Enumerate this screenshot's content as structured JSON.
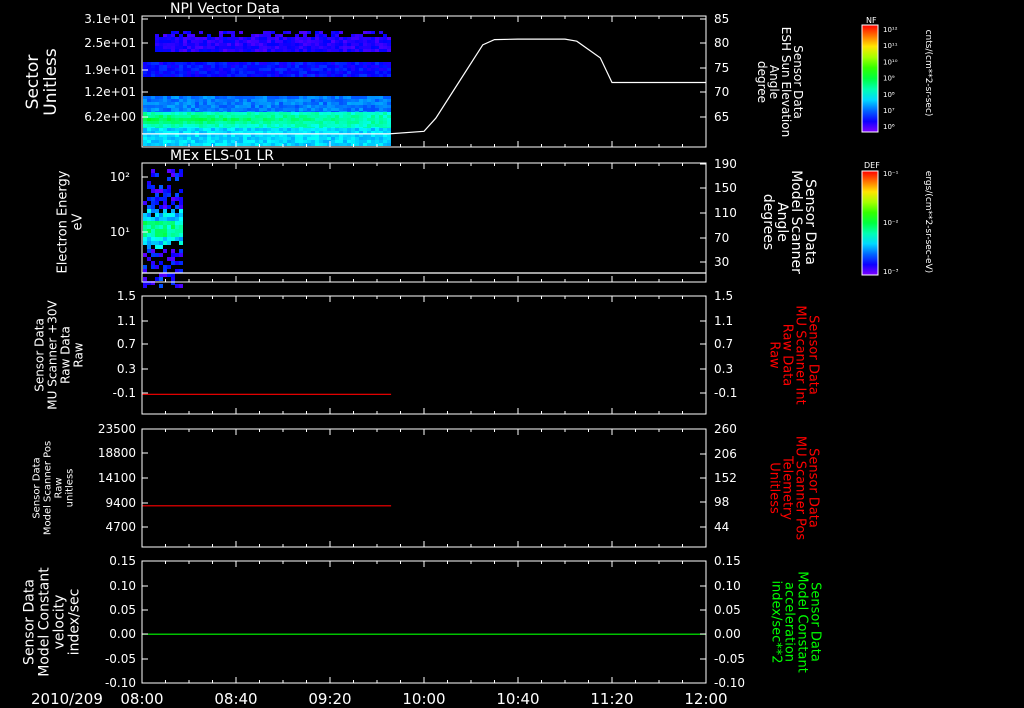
{
  "colors": {
    "background": "#000000",
    "foreground": "#ffffff",
    "red_series": "#ff0000",
    "green_series": "#00ff00"
  },
  "time_axis": {
    "date_label": "2010/209",
    "ticks": [
      "08:00",
      "08:40",
      "09:20",
      "10:00",
      "10:40",
      "11:20",
      "12:00"
    ]
  },
  "chart_data": [
    {
      "type": "heatmap",
      "title": "NPI Vector Data",
      "ylabel": [
        "Sector",
        "Unitless"
      ],
      "ytick_labels": [
        "3.1e+01",
        "2.5e+01",
        "1.9e+01",
        "1.2e+01",
        "6.2e+00"
      ],
      "right_axis": {
        "label": [
          "Sensor Data",
          "ESH Sun Elevation",
          "Angle",
          "degree"
        ],
        "ticks": [
          "85",
          "80",
          "75",
          "70",
          "65"
        ],
        "ylim": [
          60,
          85
        ]
      },
      "colorbar": {
        "title": "NF",
        "unit": "cnts/(cm**2-sr-sec)",
        "tick_labels": [
          "10¹²",
          "10¹¹",
          "10¹⁰",
          "10⁹",
          "10⁸",
          "10⁷",
          "10⁶"
        ],
        "colormap": "rainbow"
      },
      "data_extent": {
        "start": "08:00",
        "end": "09:45"
      },
      "line_series": {
        "name": "ESH Sun Elevation Angle",
        "x": [
          "08:00",
          "09:45",
          "10:00",
          "10:05",
          "10:15",
          "10:25",
          "10:30",
          "10:40",
          "11:00",
          "11:05",
          "11:15",
          "11:20",
          "12:00"
        ],
        "y": [
          62.5,
          62.5,
          63.0,
          65.5,
          72.5,
          79.5,
          80.5,
          80.6,
          80.6,
          80.2,
          77.0,
          72.3,
          72.3
        ]
      }
    },
    {
      "type": "heatmap",
      "title": "MEx ELS-01 LR",
      "ylabel": [
        "Electron Energy",
        "eV"
      ],
      "ytick_labels": [
        "10²",
        "10¹"
      ],
      "right_axis": {
        "label": [
          "Sensor Data",
          "Model Scanner",
          "Angle",
          "degrees"
        ],
        "ticks": [
          "190",
          "150",
          "110",
          "70",
          "30"
        ],
        "ylim": [
          10,
          190
        ]
      },
      "colorbar": {
        "title": "DEF",
        "unit": "ergs/(cm**2-sr-sec-eV)",
        "tick_labels": [
          "10⁻¹",
          "10⁻²",
          "10⁻³"
        ],
        "colormap": "rainbow"
      },
      "data_extent": {
        "start": "08:00",
        "end": "08:17"
      },
      "line_series": {
        "name": "Model Scanner Angle",
        "x": [
          "08:00",
          "12:00"
        ],
        "y": [
          10,
          10
        ]
      }
    },
    {
      "type": "line",
      "ylabel": [
        "Sensor Data",
        "MU Scanner +30V",
        "Raw Data",
        "Raw"
      ],
      "yticks": [
        "1.5",
        "1.1",
        "0.7",
        "0.3",
        "-0.1"
      ],
      "ylim": [
        -0.3,
        1.5
      ],
      "right_axis": {
        "label": [
          "Sensor Data",
          "MU Scanner Int",
          "Raw Data",
          "Raw"
        ],
        "ticks": [
          "1.5",
          "1.1",
          "0.7",
          "0.3",
          "-0.1"
        ],
        "color": "#ff0000"
      },
      "series": [
        {
          "color": "#ff0000",
          "x": [
            "08:00",
            "09:46"
          ],
          "y": [
            0.0,
            0.0
          ]
        }
      ]
    },
    {
      "type": "line",
      "ylabel": [
        "Sensor Data",
        "Model Scanner Pos",
        "Raw",
        "unitless"
      ],
      "yticks": [
        "23500",
        "18800",
        "14100",
        "9400",
        "4700"
      ],
      "ylim": [
        0,
        23500
      ],
      "right_axis": {
        "label": [
          "Sensor Data",
          "MU Scanner Pos",
          "Telemetry",
          "Unitless"
        ],
        "ticks": [
          "260",
          "206",
          "152",
          "98",
          "44"
        ],
        "color": "#ff0000"
      },
      "series": [
        {
          "color": "#ff0000",
          "x": [
            "08:00",
            "09:46"
          ],
          "y": [
            8200,
            8200
          ]
        }
      ]
    },
    {
      "type": "line",
      "ylabel": [
        "Sensor Data",
        "Model Constant",
        "velocity",
        "index/sec"
      ],
      "yticks": [
        "0.15",
        "0.10",
        "0.05",
        "0.00",
        "-0.05",
        "-0.10"
      ],
      "ylim": [
        -0.1,
        0.15
      ],
      "right_axis": {
        "label": [
          "Sensor Data",
          "Model Constant",
          "acceleration",
          "index/sec**2"
        ],
        "ticks": [
          "0.15",
          "0.10",
          "0.05",
          "0.00",
          "-0.05",
          "-0.10"
        ],
        "color": "#00ff00"
      },
      "series": [
        {
          "color": "#00ff00",
          "x": [
            "08:00",
            "12:00"
          ],
          "y": [
            0.0,
            0.0
          ]
        }
      ]
    }
  ]
}
